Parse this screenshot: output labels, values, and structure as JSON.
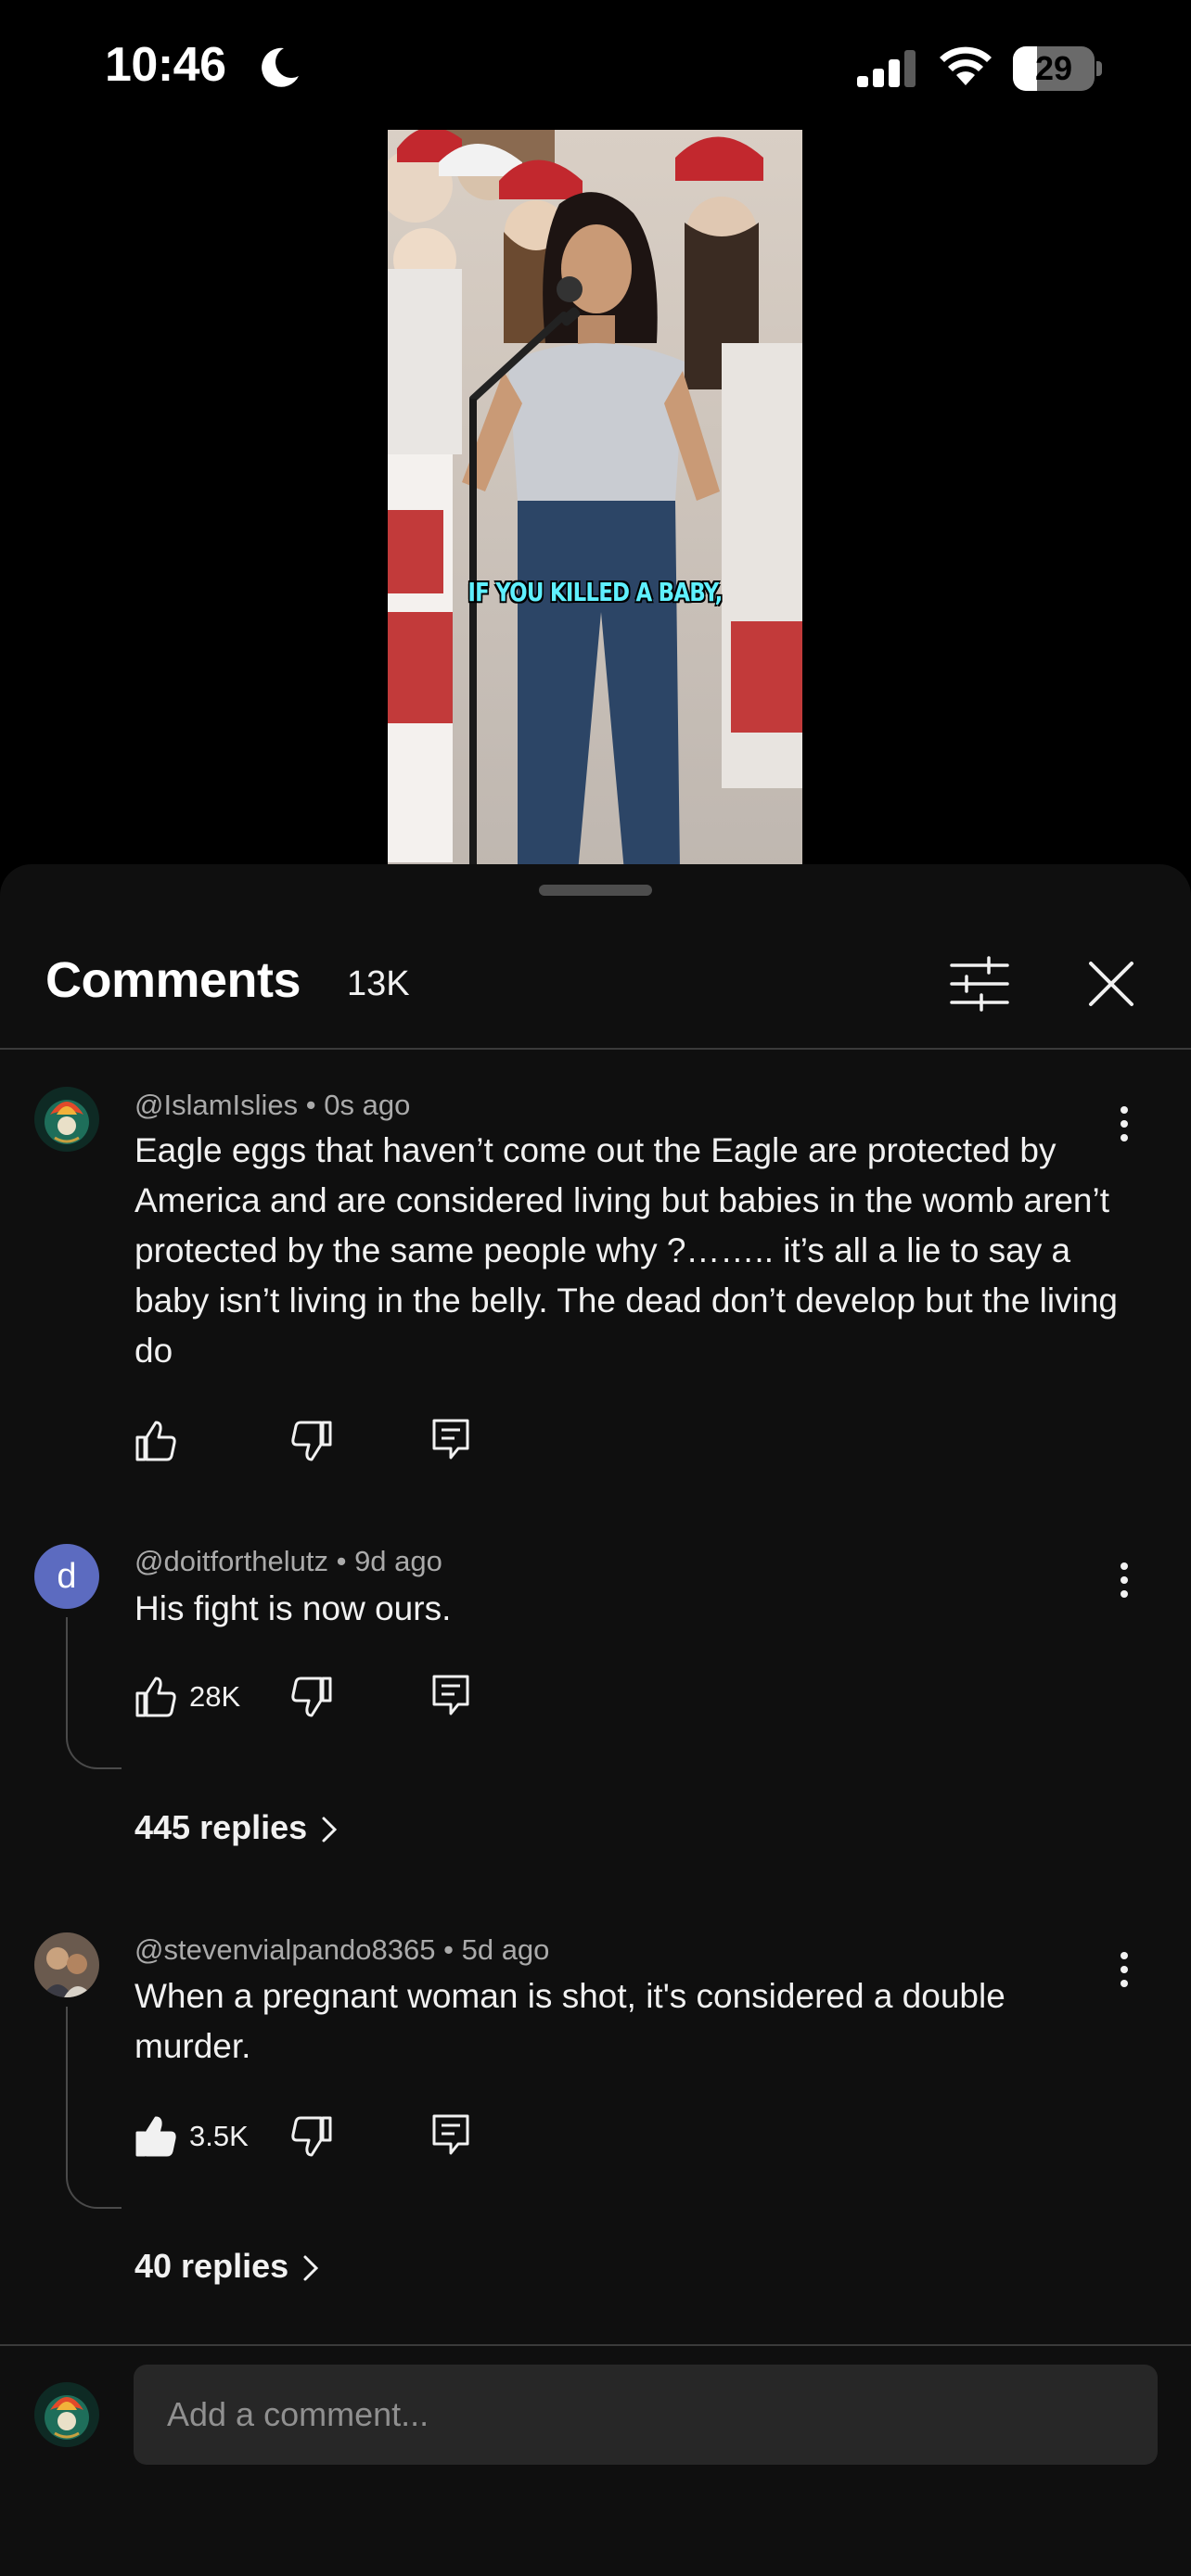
{
  "status_bar": {
    "time": "10:46",
    "battery": "29",
    "battery_level": 0.29,
    "icons": [
      "moon-icon",
      "cellular-signal-icon",
      "wifi-icon",
      "battery-icon"
    ]
  },
  "video": {
    "caption": "IF YOU KILLED A BABY,"
  },
  "comments_panel": {
    "title": "Comments",
    "count": "13K",
    "icons": [
      "filter-sliders-icon",
      "close-icon"
    ],
    "comments": [
      {
        "author": "@IslamIslies",
        "age": "0s ago",
        "text": "Eagle eggs that haven’t come out the Eagle are protected by America and are considered living but babies in the womb aren’t protected by the same people why ?…….. it’s all a lie to say a baby isn’t living in the belly. The dead don’t develop but the living do",
        "likes": "",
        "replies": ""
      },
      {
        "author": "@doitforthelutz",
        "age": "9d ago",
        "avatar_letter": "d",
        "text": "His fight is now ours.",
        "likes": "28K",
        "replies": "445 replies"
      },
      {
        "author": "@stevenvialpando8365",
        "age": "5d ago",
        "text": "When a pregnant woman is shot, it's considered a double murder.",
        "likes": "3.5K",
        "liked": true,
        "replies": "40 replies"
      }
    ]
  },
  "composer": {
    "placeholder": "Add a comment..."
  },
  "colors": {
    "sheet_background": "#0f0f0f",
    "input_background": "#272727",
    "avatar_d": "#5c6bc0",
    "caption": "#5ff0ff"
  }
}
